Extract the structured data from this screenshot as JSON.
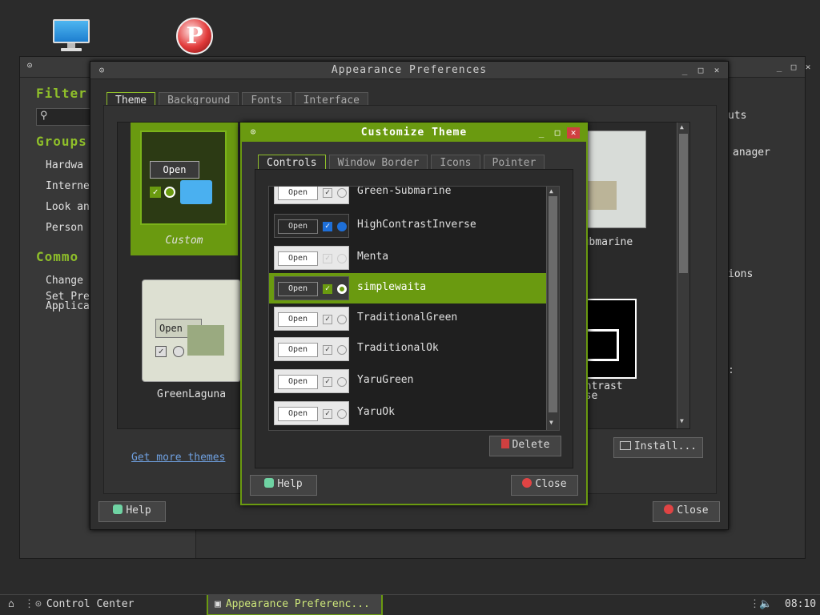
{
  "desktop": {
    "icons": [
      "computer-icon",
      "p-app-icon"
    ]
  },
  "control_center": {
    "filter_label": "Filter",
    "groups_label": "Groups",
    "group_items": [
      "Hardwa",
      "Interne",
      "Look an",
      "Person"
    ],
    "common_label": "Commo",
    "common_items": [
      "Change",
      "Set Pre",
      "Applica"
    ],
    "right_items": [
      "uts",
      "anager",
      "ions",
      ":"
    ]
  },
  "appearance": {
    "title": "Appearance Preferences",
    "tabs": [
      "Theme",
      "Background",
      "Fonts",
      "Interface"
    ],
    "thumbs": [
      {
        "name": "Custom",
        "selected": true
      },
      {
        "name": "Submarine"
      },
      {
        "name": "GreenLaguna"
      },
      {
        "name": "Contrast",
        "name2": "erse"
      }
    ],
    "thumb_open_label": "Open",
    "more_themes_link": "Get more themes",
    "install_label": "Install...",
    "help_label": "Help",
    "close_label": "Close"
  },
  "customize": {
    "title": "Customize Theme",
    "tabs": [
      "Controls",
      "Window Border",
      "Icons",
      "Pointer"
    ],
    "themes": [
      {
        "name": "Green-Submarine",
        "dark": false
      },
      {
        "name": "HighContrastInverse",
        "dark": true
      },
      {
        "name": "Menta",
        "dark": false
      },
      {
        "name": "simplewaita",
        "dark": true,
        "selected": true
      },
      {
        "name": "TraditionalGreen",
        "dark": false
      },
      {
        "name": "TraditionalOk",
        "dark": false
      },
      {
        "name": "YaruGreen",
        "dark": false
      },
      {
        "name": "YaruOk",
        "dark": false
      }
    ],
    "preview_open_label": "Open",
    "delete_label": "Delete",
    "help_label": "Help",
    "close_label": "Close"
  },
  "taskbar": {
    "control_center_label": "Control Center",
    "appearance_label": "Appearance Preferenc...",
    "clock": "08:10"
  },
  "colors": {
    "accent": "#6a9a10",
    "bg": "#2b2b2b"
  }
}
